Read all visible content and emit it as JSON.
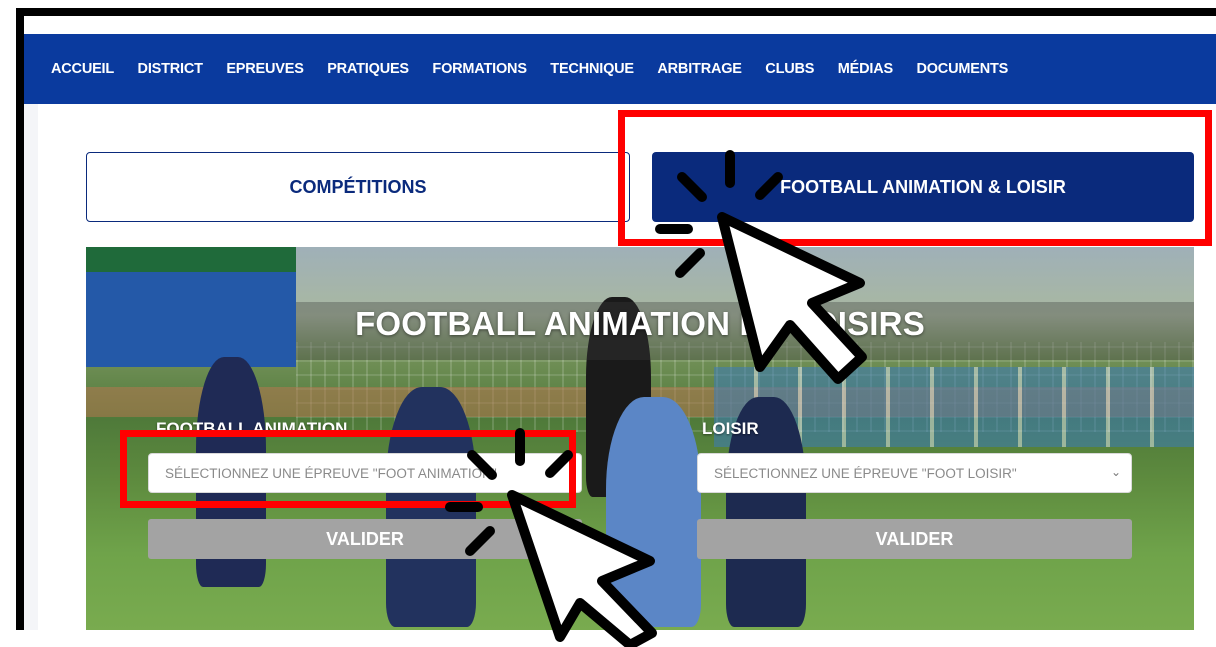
{
  "nav": {
    "items": [
      "ACCUEIL",
      "DISTRICT",
      "EPREUVES",
      "PRATIQUES",
      "FORMATIONS",
      "TECHNIQUE",
      "ARBITRAGE",
      "CLUBS",
      "MÉDIAS",
      "DOCUMENTS"
    ]
  },
  "tabs": {
    "competitions": "COMPÉTITIONS",
    "football_animation": "FOOTBALL ANIMATION & LOISIR"
  },
  "hero": {
    "title": "FOOTBALL ANIMATION ET LOISIRS",
    "animation": {
      "label": "FOOTBALL ANIMATION",
      "select_value": "SÉLECTIONNEZ UNE ÉPREUVE \"FOOT ANIMATION\"",
      "button": "VALIDER"
    },
    "loisir": {
      "label": "LOISIR",
      "select_value": "SÉLECTIONNEZ UNE ÉPREUVE \"FOOT LOISIR\"",
      "button": "VALIDER"
    }
  },
  "colors": {
    "nav_blue": "#0a3a9e",
    "tab_blue": "#0a2a7c",
    "highlight_red": "#ff0000",
    "button_gray": "#a3a3a3"
  },
  "icons": [
    "click-cursor-icon",
    "chevron-down-icon"
  ]
}
